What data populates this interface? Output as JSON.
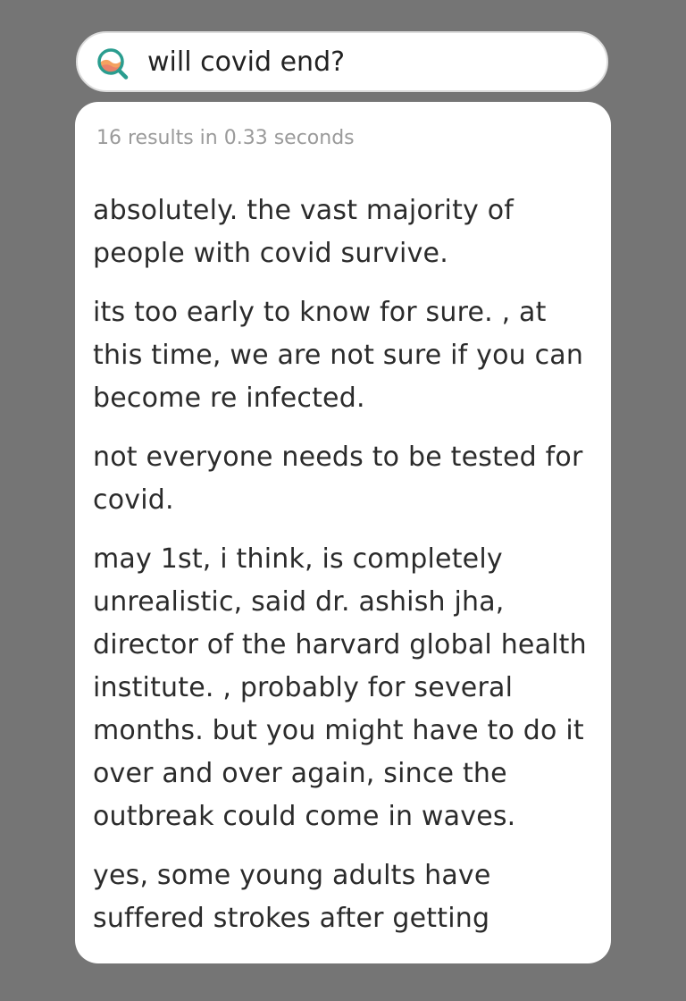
{
  "search": {
    "query": "will covid end?",
    "icon": "search-icon",
    "accent_colors": [
      "#2a9d8f",
      "#f4a261",
      "#e76f51"
    ]
  },
  "results": {
    "meta": "16 results in 0.33 seconds",
    "items": [
      "absolutely. the vast majority of people with covid survive.",
      "its too early to know for sure. , at this time, we are not sure if you can become re infected.",
      "not everyone needs to be tested for covid.",
      "may 1st, i think, is completely unrealistic, said dr. ashish jha, director of the harvard global health institute. , probably for several months. but you might have to do it over and over again, since the outbreak could come in waves.",
      "yes, some young adults have suffered strokes after getting"
    ]
  }
}
